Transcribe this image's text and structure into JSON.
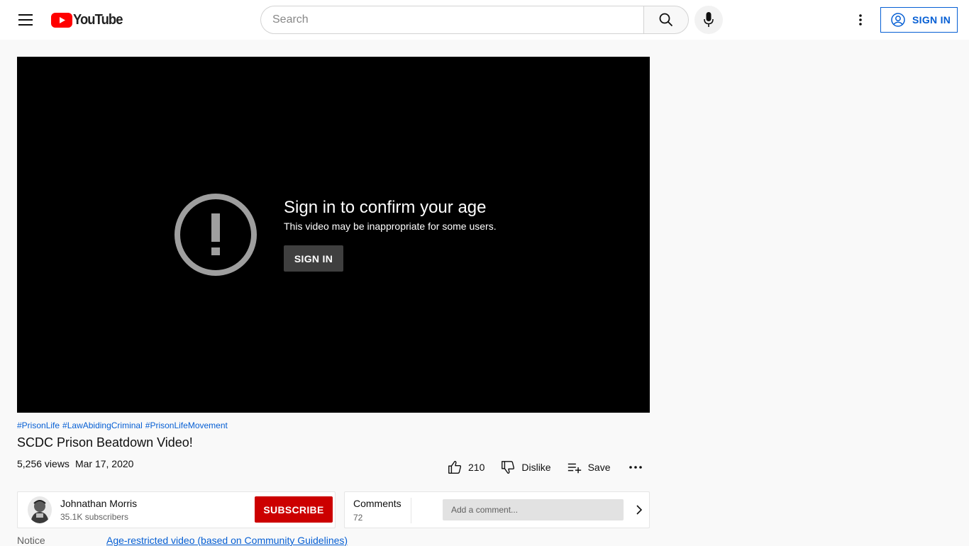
{
  "header": {
    "logo_text": "YouTube",
    "search": {
      "placeholder": "Search",
      "value": ""
    },
    "signin_label": "SIGN IN"
  },
  "player": {
    "gate_title": "Sign in to confirm your age",
    "gate_subtitle": "This video may be inappropriate for some users.",
    "gate_button": "SIGN IN"
  },
  "video": {
    "hashtags": [
      "#PrisonLife",
      "#LawAbidingCriminal",
      "#PrisonLifeMovement"
    ],
    "title": "SCDC Prison Beatdown Video!",
    "views": "5,256 views",
    "date": "Mar 17, 2020",
    "likes": "210",
    "dislike_label": "Dislike",
    "save_label": "Save"
  },
  "owner": {
    "name": "Johnathan Morris",
    "subscribers": "35.1K subscribers",
    "subscribe_label": "SUBSCRIBE"
  },
  "comments": {
    "title": "Comments",
    "count": "72",
    "placeholder": "Add a comment..."
  },
  "notice": {
    "label": "Notice",
    "link": "Age-restricted video (based on Community Guidelines)"
  },
  "colors": {
    "brand_red": "#ff0000",
    "link_blue": "#065fd4",
    "subscribe_red": "#cc0000"
  }
}
